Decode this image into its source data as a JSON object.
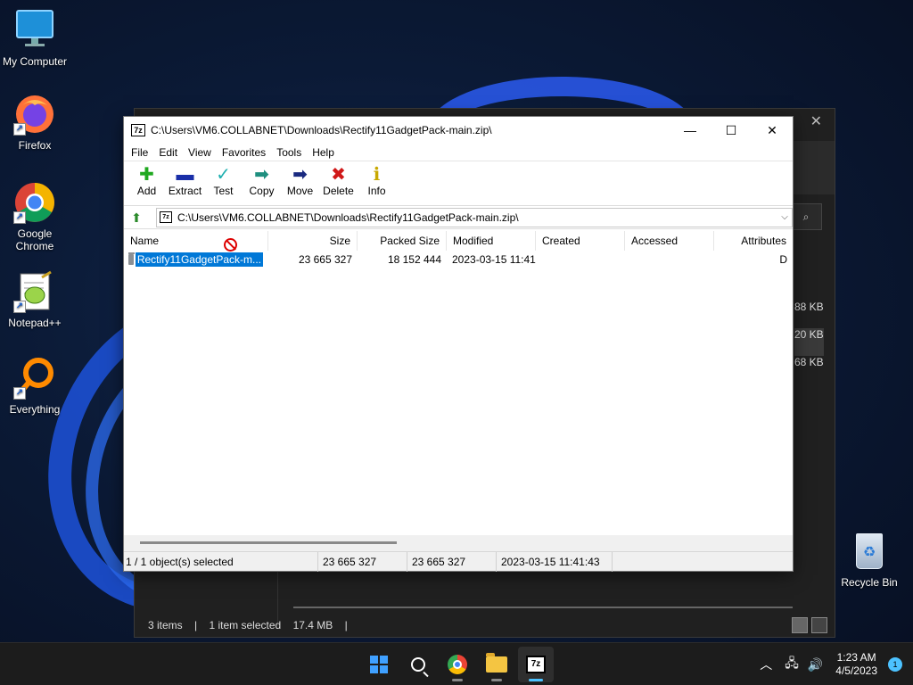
{
  "desktop": {
    "icons": [
      {
        "label": "My Computer"
      },
      {
        "label": "Firefox"
      },
      {
        "label": "Google Chrome"
      },
      {
        "label": "Notepad++"
      },
      {
        "label": "Everything"
      }
    ],
    "recycle_bin": "Recycle Bin"
  },
  "bg_explorer": {
    "sizes": [
      "88 KB",
      "20 KB",
      "68 KB"
    ],
    "status": {
      "items": "3 items",
      "selected": "1 item selected",
      "size": "17.4 MB",
      "sep": "|"
    },
    "close": "✕",
    "search_icon": "⌕"
  },
  "zip": {
    "app_icon": "7z",
    "title": "C:\\Users\\VM6.COLLABNET\\Downloads\\Rectify11GadgetPack-main.zip\\",
    "window_controls": {
      "minimize": "—",
      "maximize": "☐",
      "close": "✕"
    },
    "menu": [
      "File",
      "Edit",
      "View",
      "Favorites",
      "Tools",
      "Help"
    ],
    "toolbar": [
      {
        "label": "Add",
        "glyph": "✚",
        "color": "#1fa81f"
      },
      {
        "label": "Extract",
        "glyph": "▬",
        "color": "#1a2fa8"
      },
      {
        "label": "Test",
        "glyph": "✓",
        "color": "#1fb0b0"
      },
      {
        "label": "Copy",
        "glyph": "➡",
        "color": "#1f8f7f"
      },
      {
        "label": "Move",
        "glyph": "➡",
        "color": "#1a2a80"
      },
      {
        "label": "Delete",
        "glyph": "✖",
        "color": "#d01818"
      },
      {
        "label": "Info",
        "glyph": "ℹ",
        "color": "#c8a800"
      }
    ],
    "address": {
      "up": "⬆",
      "path": "C:\\Users\\VM6.COLLABNET\\Downloads\\Rectify11GadgetPack-main.zip\\",
      "dropdown": "⌵"
    },
    "columns": [
      "Name",
      "Size",
      "Packed Size",
      "Modified",
      "Created",
      "Accessed",
      "Attributes"
    ],
    "rows": [
      {
        "name": "Rectify11GadgetPack-m...",
        "size": "23 665 327",
        "packed": "18 152 444",
        "modified": "2023-03-15 11:41",
        "created": "",
        "accessed": "",
        "attr": "D"
      }
    ],
    "status": {
      "selection": "1 / 1 object(s) selected",
      "size": "23 665 327",
      "packed": "23 665 327",
      "modified": "2023-03-15 11:41:43"
    }
  },
  "taskbar": {
    "tray": {
      "chevron": "︿",
      "network": "🖧",
      "volume": "🔊",
      "time": "1:23 AM",
      "date": "4/5/2023",
      "notifications": "1"
    },
    "sz_label": "7z"
  }
}
